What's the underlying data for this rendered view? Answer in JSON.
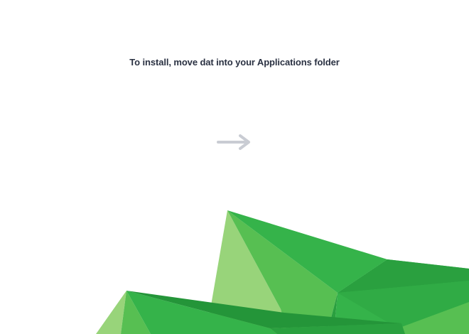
{
  "window": {
    "instruction_text": "To install, move dat into your Applications folder"
  },
  "icons": {
    "arrow": "arrow-right-icon",
    "background_art": "green-polygon-art"
  },
  "colors": {
    "background": "#ffffff",
    "text": "#2a3142",
    "arrow": "#c9ccd3",
    "green_light": "#98d47a",
    "green_mid": "#57bf52",
    "green_main": "#35b34a",
    "green_dark": "#2aa03f",
    "green_darker": "#249539"
  }
}
